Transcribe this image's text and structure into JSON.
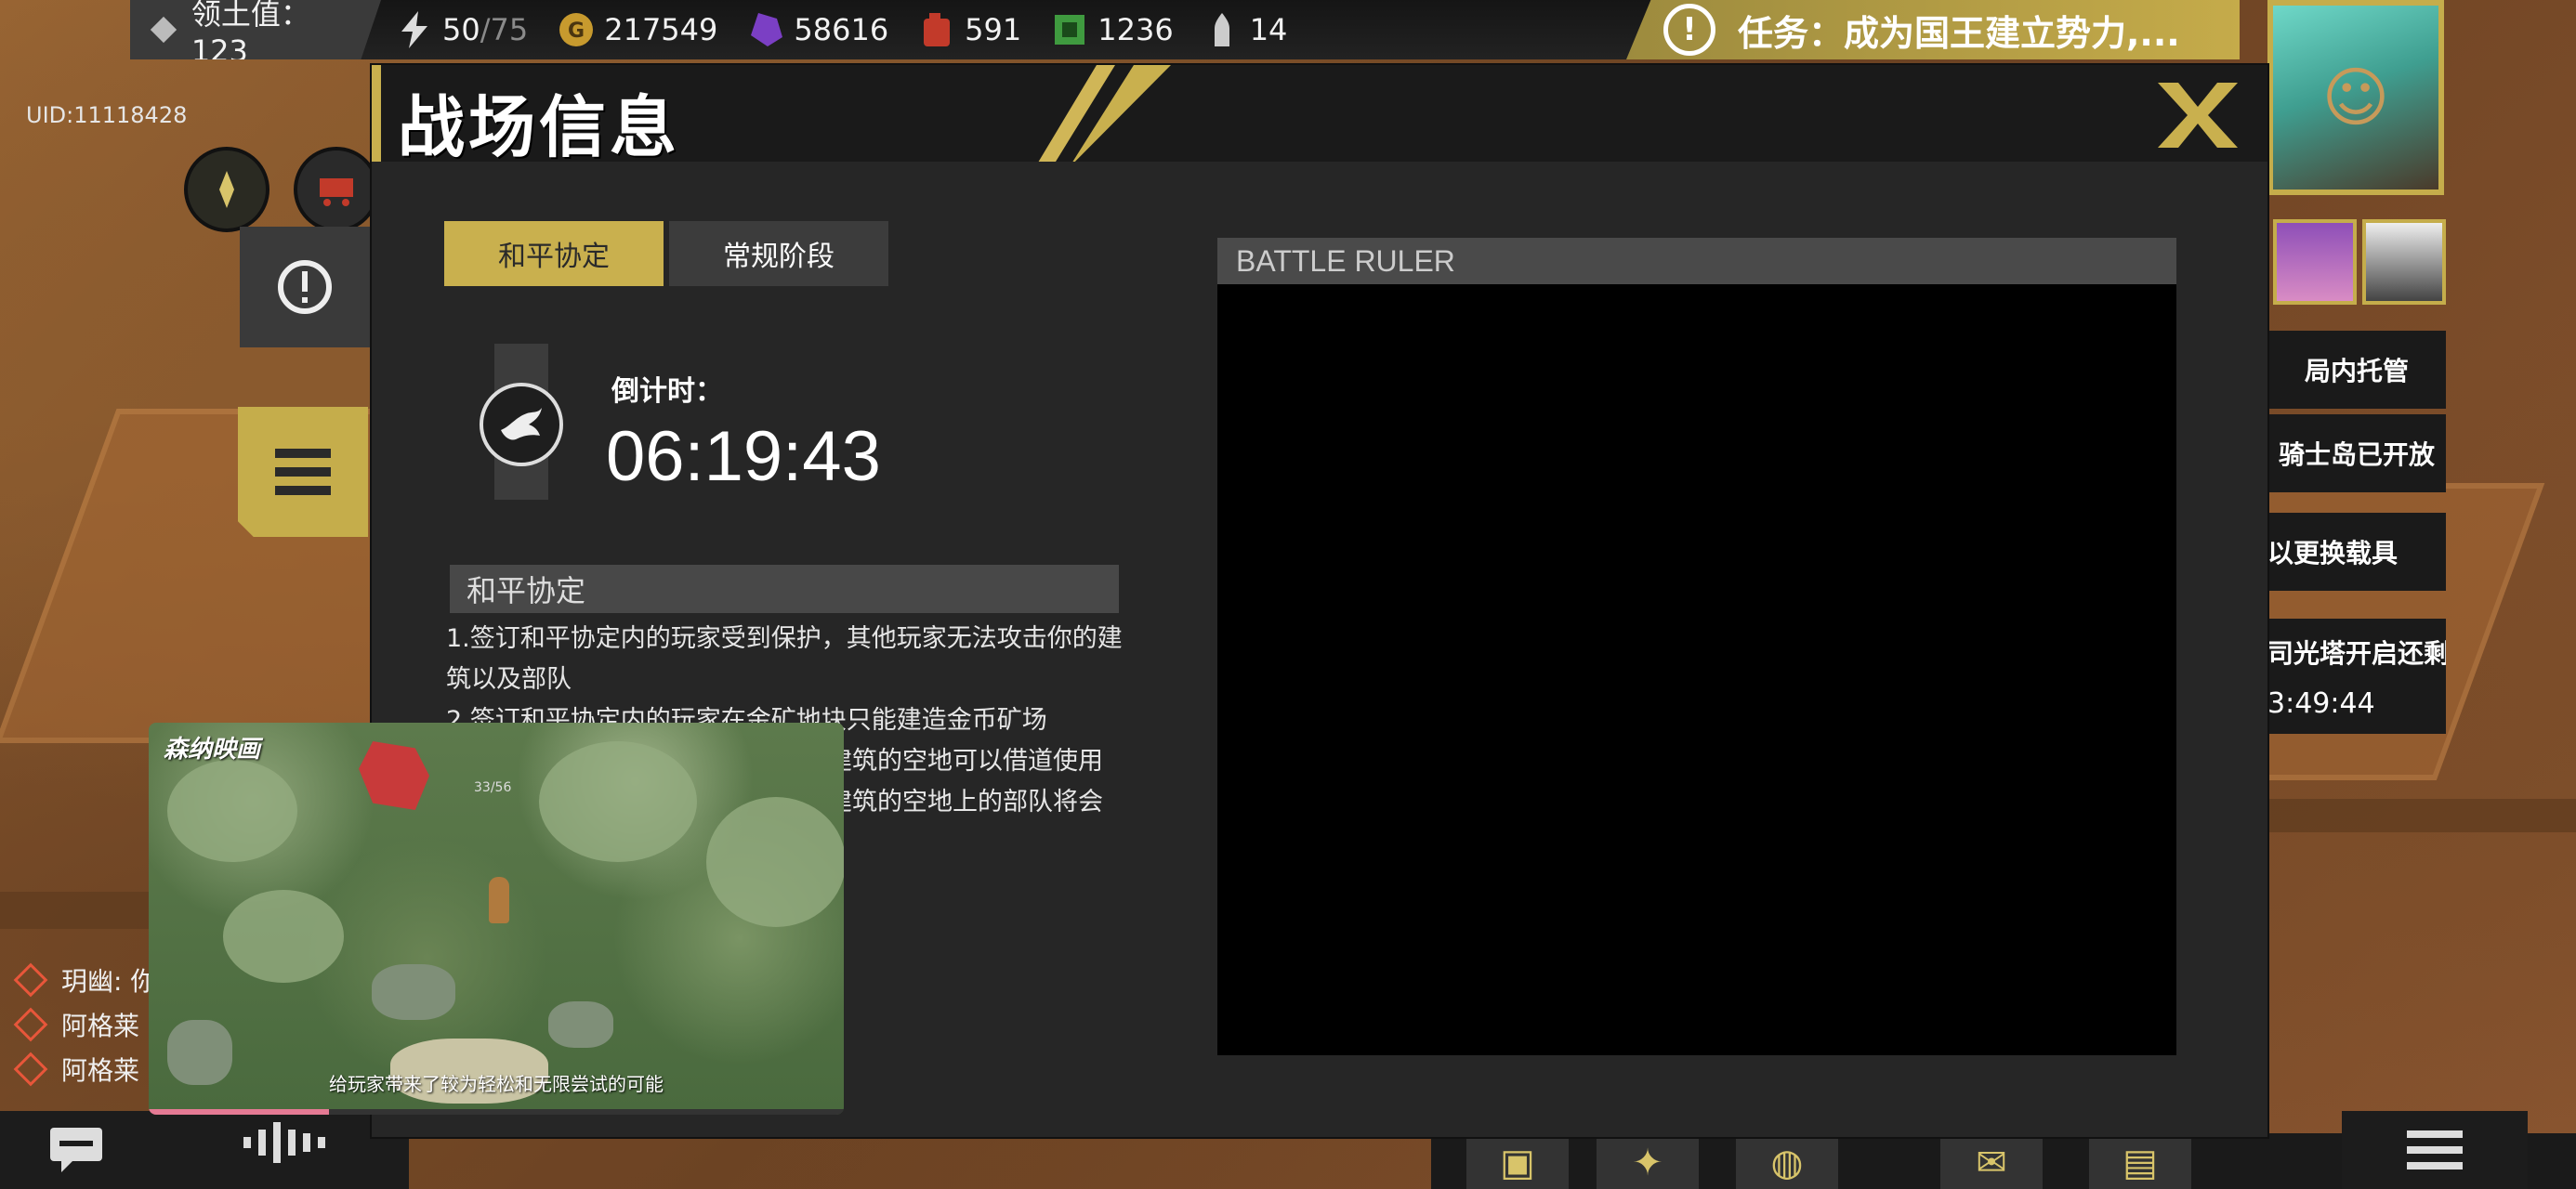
{
  "topbar": {
    "territory_label": "领土值：123",
    "energy_value": "50",
    "energy_max": "/75",
    "gold": "217549",
    "crystal": "58616",
    "fuel": "591",
    "chip": "1236",
    "ammo": "14",
    "mission": "任务：成为国王建立势力,..."
  },
  "uid": "UID:11118428",
  "side_panel": {
    "items": [
      "局内托管",
      "骑士岛已开放",
      "以更换载具",
      "司光塔开启还剩",
      "3:49:44"
    ]
  },
  "players": [
    "玥幽: 你",
    "阿格莱",
    "阿格莱"
  ],
  "modal": {
    "title": "战场信息",
    "tabs": [
      {
        "label": "和平协定",
        "active": true
      },
      {
        "label": "常规阶段",
        "active": false
      }
    ],
    "countdown_label": "倒计时：",
    "countdown_time": "06:19:43",
    "section_title": "和平协定",
    "rules": [
      "1.签订和平协定内的玩家受到保护，其他玩家无法攻击你的建筑以及部队",
      "2.签订和平协定内的玩家在金矿地块只能建造金币矿场",
      "建筑的空地可以借道使用",
      "建筑的空地上的部队将会"
    ],
    "ruler_title": "BATTLE RULER"
  },
  "video": {
    "title": "森纳映画",
    "subtitle": "给玩家带来了较为轻松和无限尝试的可能",
    "counter": "33/56",
    "progress": 0.26
  },
  "colors": {
    "accent": "#c9b04e",
    "panel": "#262626",
    "header": "#1a1a1a"
  }
}
